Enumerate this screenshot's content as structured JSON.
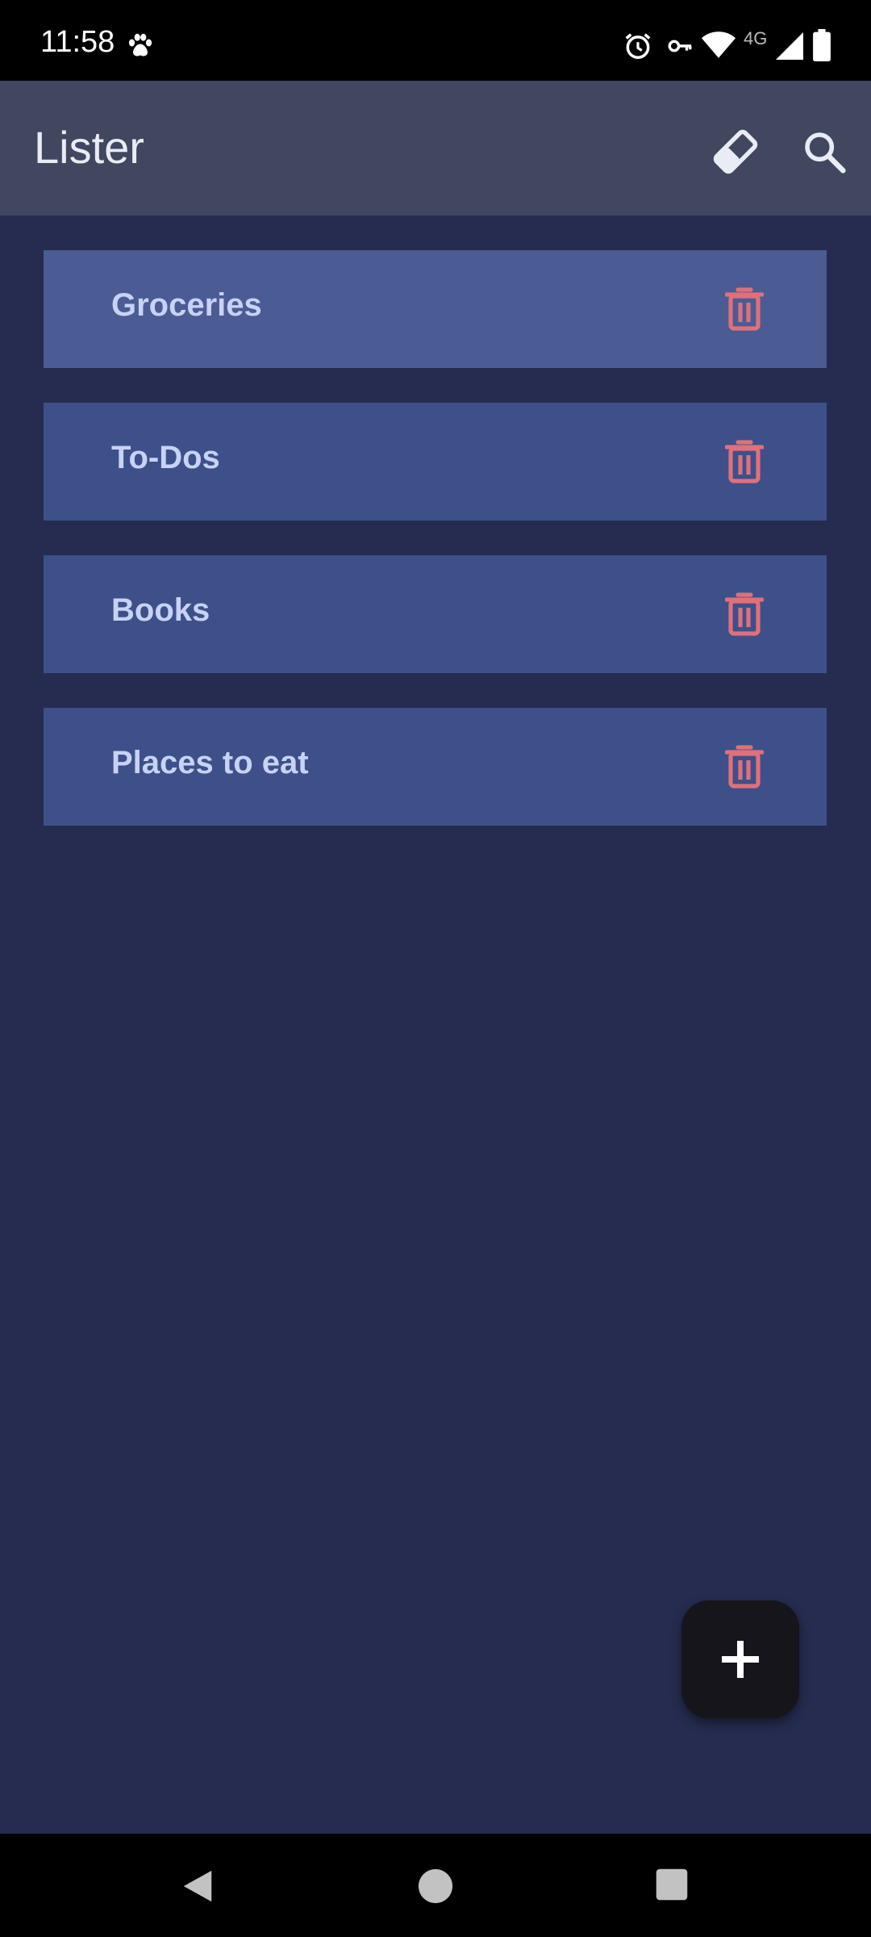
{
  "status_bar": {
    "time": "11:58",
    "network_label": "4G",
    "icons": [
      "paw-icon",
      "alarm-icon",
      "vpn-key-icon",
      "wifi-icon",
      "cell-signal-icon",
      "battery-icon"
    ]
  },
  "app_bar": {
    "title": "Lister",
    "actions": [
      "eraser-icon",
      "search-icon"
    ]
  },
  "lists": [
    {
      "label": "Groceries",
      "selected": true
    },
    {
      "label": "To-Dos",
      "selected": false
    },
    {
      "label": "Books",
      "selected": false
    },
    {
      "label": "Places to eat",
      "selected": false
    }
  ],
  "fab": {
    "icon": "plus-icon"
  },
  "nav_bar": {
    "buttons": [
      "back-icon",
      "home-icon",
      "recents-icon"
    ]
  },
  "colors": {
    "background": "#252c50",
    "app_bar": "#40475f",
    "card": "#3d5089",
    "card_selected": "#4b5b93",
    "card_text": "#c8d2f5",
    "delete_icon": "#e0707a",
    "fab": "#15151b"
  }
}
